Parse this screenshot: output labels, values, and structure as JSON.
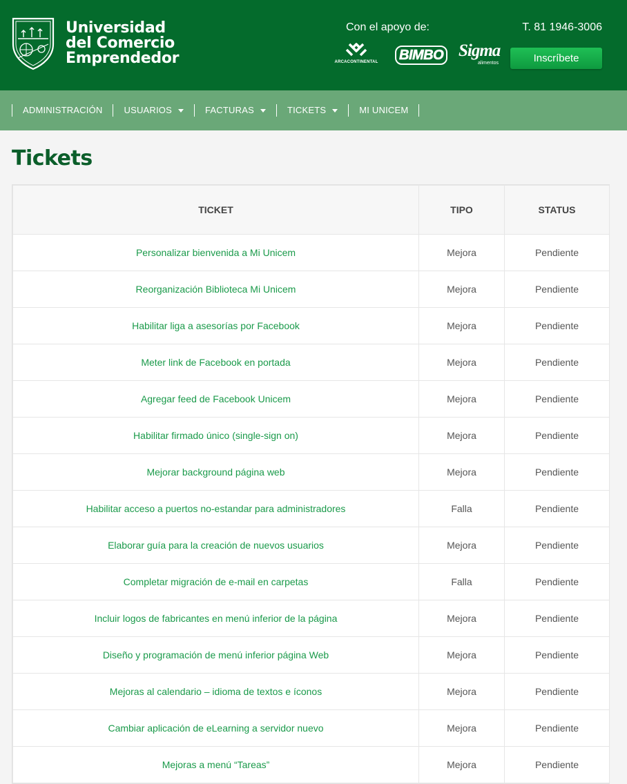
{
  "header": {
    "university_line1": "Universidad",
    "university_line2": "del Comercio",
    "university_line3": "Emprendedor",
    "support_label": "Con el apoyo de:",
    "phone": "T. 81 1946-3006",
    "cta_label": "Inscríbete",
    "sponsors": {
      "arca": "ARCACONTINENTAL",
      "bimbo": "BIMBO",
      "sigma": "Sigma",
      "sigma_sub": "alimentos"
    }
  },
  "nav": {
    "items": [
      {
        "label": "ADMINISTRACIÓN"
      },
      {
        "label": "USUARIOS"
      },
      {
        "label": "FACTURAS"
      },
      {
        "label": "TICKETS"
      },
      {
        "label": "MI UNICEM"
      }
    ]
  },
  "page": {
    "title": "Tickets"
  },
  "table": {
    "headers": [
      "TICKET",
      "TIPO",
      "STATUS"
    ],
    "rows": [
      {
        "ticket": "Personalizar bienvenida a Mi Unicem",
        "tipo": "Mejora",
        "status": "Pendiente"
      },
      {
        "ticket": "Reorganización Biblioteca Mi Unicem",
        "tipo": "Mejora",
        "status": "Pendiente"
      },
      {
        "ticket": "Habilitar liga a asesorías por Facebook",
        "tipo": "Mejora",
        "status": "Pendiente"
      },
      {
        "ticket": "Meter link de Facebook en portada",
        "tipo": "Mejora",
        "status": "Pendiente"
      },
      {
        "ticket": "Agregar feed de Facebook Unicem",
        "tipo": "Mejora",
        "status": "Pendiente"
      },
      {
        "ticket": "Habilitar firmado único (single-sign on)",
        "tipo": "Mejora",
        "status": "Pendiente"
      },
      {
        "ticket": "Mejorar background página web",
        "tipo": "Mejora",
        "status": "Pendiente"
      },
      {
        "ticket": "Habilitar acceso a puertos no-estandar para administradores",
        "tipo": "Falla",
        "status": "Pendiente"
      },
      {
        "ticket": "Elaborar guía para la creación de nuevos usuarios",
        "tipo": "Mejora",
        "status": "Pendiente"
      },
      {
        "ticket": "Completar migración de e-mail en carpetas",
        "tipo": "Falla",
        "status": "Pendiente"
      },
      {
        "ticket": "Incluir logos de fabricantes en menú inferior de la página",
        "tipo": "Mejora",
        "status": "Pendiente"
      },
      {
        "ticket": "Diseño y programación de menú inferior página Web",
        "tipo": "Mejora",
        "status": "Pendiente"
      },
      {
        "ticket": "Mejoras al calendario – idioma de textos e íconos",
        "tipo": "Mejora",
        "status": "Pendiente"
      },
      {
        "ticket": "Cambiar aplicación de eLearning a servidor nuevo",
        "tipo": "Mejora",
        "status": "Pendiente"
      },
      {
        "ticket": "Mejoras a menú “Tareas”",
        "tipo": "Mejora",
        "status": "Pendiente"
      }
    ]
  }
}
